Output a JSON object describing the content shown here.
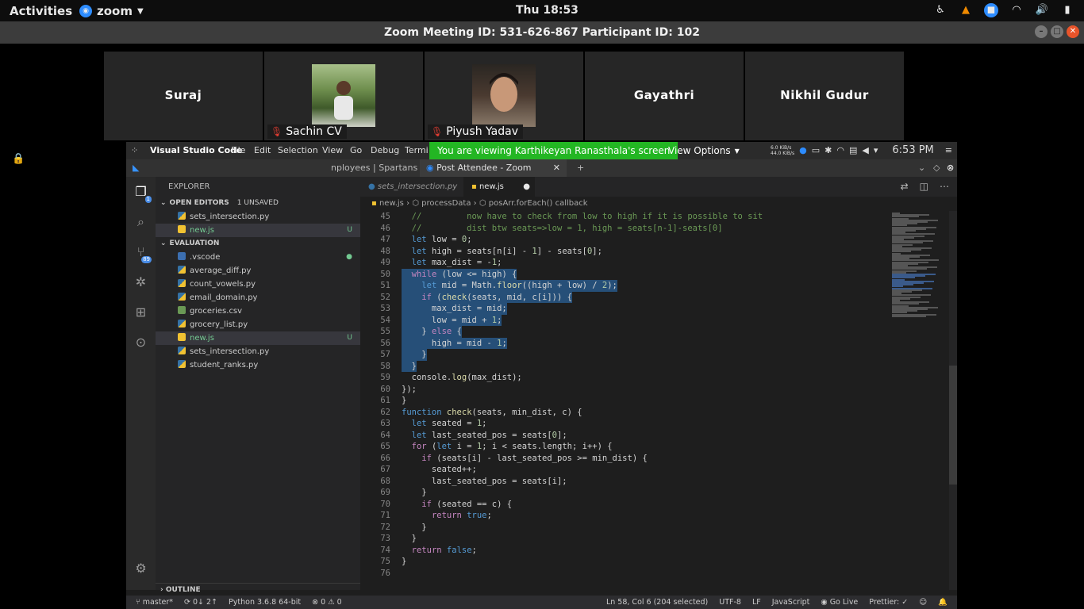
{
  "topbar": {
    "activities": "Activities",
    "app_name": "zoom",
    "clock": "Thu 18:53"
  },
  "zoom_window": {
    "title": "Zoom Meeting ID: 531-626-867 Participant ID: 102"
  },
  "participants": [
    {
      "name": "Suraj",
      "video": false,
      "muted": false
    },
    {
      "name": "Sachin CV",
      "video": true,
      "muted": true
    },
    {
      "name": "Piyush Yadav",
      "video": true,
      "muted": true
    },
    {
      "name": "Gayathri",
      "video": false,
      "muted": false
    },
    {
      "name": "Nikhil Gudur",
      "video": false,
      "muted": false
    }
  ],
  "shared": {
    "banner": "You are viewing Karthikeyan Ranasthala's screen",
    "view_options": "View Options",
    "remote_app": "Visual Studio Code",
    "remote_menu": [
      "File",
      "Edit",
      "Selection",
      "View",
      "Go",
      "Debug",
      "Termi"
    ],
    "net_speed_up": "6.0 KiB/s",
    "net_speed_down": "44.0 KiB/s",
    "remote_clock": "6:53 PM",
    "browser_tabs": [
      "nployees | Spartans",
      "Post Attendee - Zoom"
    ]
  },
  "vscode": {
    "explorer_title": "EXPLORER",
    "open_editors_label": "OPEN EDITORS",
    "unsaved": "1 UNSAVED",
    "open_editors": [
      {
        "name": "sets_intersection.py",
        "type": "py",
        "status": ""
      },
      {
        "name": "new.js",
        "type": "js",
        "status": "U"
      }
    ],
    "folder_label": "EVALUATION",
    "files": [
      {
        "name": ".vscode",
        "type": "dir",
        "status": "●"
      },
      {
        "name": "average_diff.py",
        "type": "py",
        "status": ""
      },
      {
        "name": "count_vowels.py",
        "type": "py",
        "status": ""
      },
      {
        "name": "email_domain.py",
        "type": "py",
        "status": ""
      },
      {
        "name": "groceries.csv",
        "type": "csv",
        "status": ""
      },
      {
        "name": "grocery_list.py",
        "type": "py",
        "status": ""
      },
      {
        "name": "new.js",
        "type": "js",
        "status": "U"
      },
      {
        "name": "sets_intersection.py",
        "type": "py",
        "status": ""
      },
      {
        "name": "student_ranks.py",
        "type": "py",
        "status": ""
      }
    ],
    "outline_label": "OUTLINE",
    "editor_tabs": [
      {
        "label": "sets_intersection.py",
        "active": false
      },
      {
        "label": "new.js",
        "active": true
      }
    ],
    "breadcrumb": [
      "new.js",
      "processData",
      "posArr.forEach() callback"
    ],
    "code_lines": [
      {
        "n": "45",
        "t": "  //         now have to check from low to high if it is possible to sit",
        "hl": false
      },
      {
        "n": "46",
        "t": "  //         dist btw seats=>low = 1, high = seats[n-1]-seats[0]",
        "hl": false
      },
      {
        "n": "47",
        "t": "  let low = 0;",
        "hl": false
      },
      {
        "n": "48",
        "t": "  let high = seats[n[i] - 1] - seats[0];",
        "hl": false
      },
      {
        "n": "49",
        "t": "  let max_dist = -1;",
        "hl": false
      },
      {
        "n": "50",
        "t": "  while (low <= high) {",
        "hl": true
      },
      {
        "n": "51",
        "t": "    let mid = Math.floor((high + low) / 2);",
        "hl": true
      },
      {
        "n": "52",
        "t": "    if (check(seats, mid, c[i])) {",
        "hl": true
      },
      {
        "n": "53",
        "t": "      max_dist = mid;",
        "hl": true
      },
      {
        "n": "54",
        "t": "      low = mid + 1;",
        "hl": true
      },
      {
        "n": "55",
        "t": "    } else {",
        "hl": true
      },
      {
        "n": "56",
        "t": "      high = mid - 1;",
        "hl": true
      },
      {
        "n": "57",
        "t": "    }",
        "hl": true
      },
      {
        "n": "58",
        "t": "  }",
        "hl": true
      },
      {
        "n": "59",
        "t": "  console.log(max_dist);",
        "hl": false
      },
      {
        "n": "60",
        "t": "});",
        "hl": false
      },
      {
        "n": "61",
        "t": "}",
        "hl": false
      },
      {
        "n": "62",
        "t": "function check(seats, min_dist, c) {",
        "hl": false
      },
      {
        "n": "63",
        "t": "  let seated = 1;",
        "hl": false
      },
      {
        "n": "64",
        "t": "  let last_seated_pos = seats[0];",
        "hl": false
      },
      {
        "n": "65",
        "t": "  for (let i = 1; i < seats.length; i++) {",
        "hl": false
      },
      {
        "n": "66",
        "t": "    if (seats[i] - last_seated_pos >= min_dist) {",
        "hl": false
      },
      {
        "n": "67",
        "t": "      seated++;",
        "hl": false
      },
      {
        "n": "68",
        "t": "      last_seated_pos = seats[i];",
        "hl": false
      },
      {
        "n": "69",
        "t": "    }",
        "hl": false
      },
      {
        "n": "70",
        "t": "    if (seated == c) {",
        "hl": false
      },
      {
        "n": "71",
        "t": "      return true;",
        "hl": false
      },
      {
        "n": "72",
        "t": "    }",
        "hl": false
      },
      {
        "n": "73",
        "t": "  }",
        "hl": false
      },
      {
        "n": "74",
        "t": "  return false;",
        "hl": false
      },
      {
        "n": "75",
        "t": "}",
        "hl": false
      },
      {
        "n": "76",
        "t": "",
        "hl": false
      }
    ],
    "status": {
      "branch": "master*",
      "sync": "0↓ 2↑",
      "python": "Python 3.6.8 64-bit",
      "problems": "⊗ 0 ⚠ 0",
      "cursor": "Ln 58, Col 6 (204 selected)",
      "encoding": "UTF-8",
      "eol": "LF",
      "language": "JavaScript",
      "golive": "Go Live",
      "prettier": "Prettier: ✓"
    },
    "scm_badge": "89",
    "explorer_badge": "1"
  }
}
